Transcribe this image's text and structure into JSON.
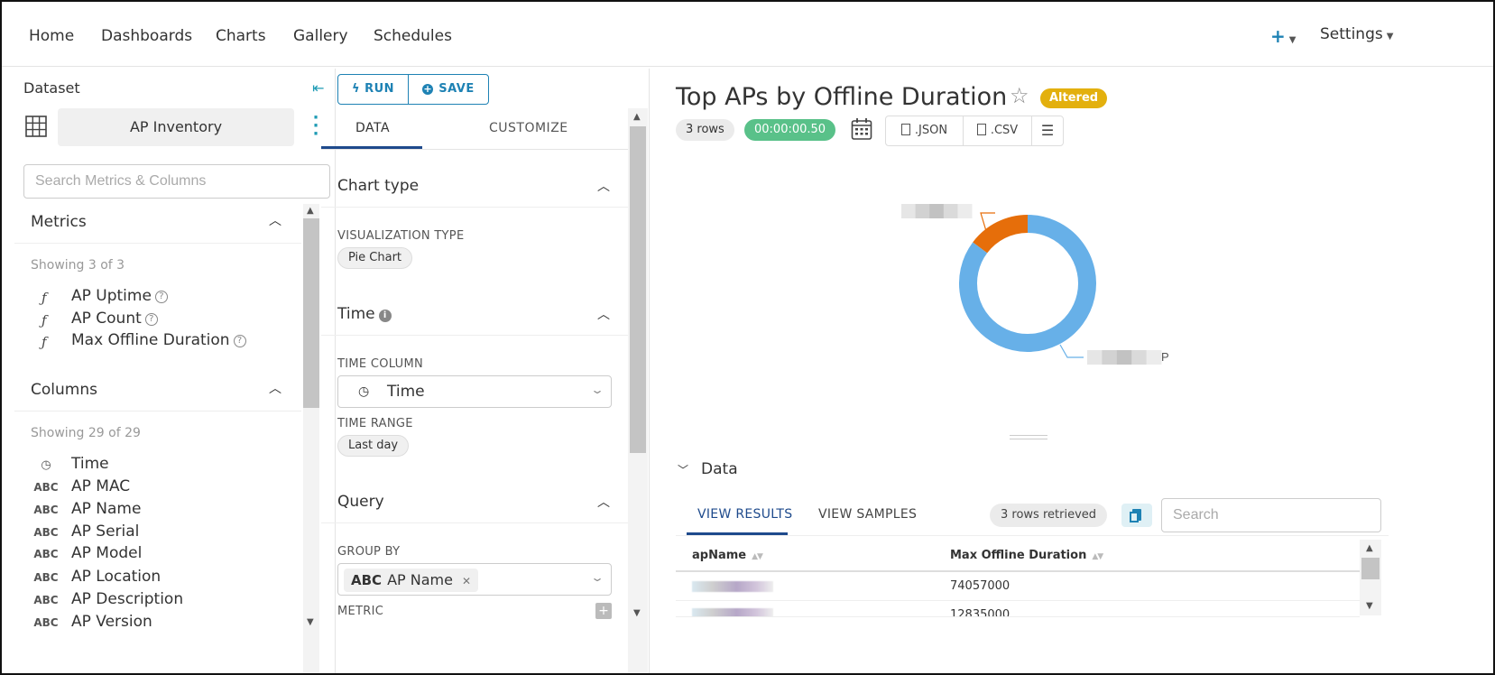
{
  "nav": {
    "items": [
      "Home",
      "Dashboards",
      "Charts",
      "Gallery",
      "Schedules"
    ],
    "settings": "Settings",
    "plus_label": "+"
  },
  "dataset": {
    "title": "Dataset",
    "name": "AP Inventory",
    "search_placeholder": "Search Metrics & Columns",
    "metrics_title": "Metrics",
    "metrics_showing": "Showing 3 of 3",
    "metrics": [
      "AP Uptime",
      "AP Count",
      "Max Offline Duration"
    ],
    "columns_title": "Columns",
    "columns_showing": "Showing 29 of 29",
    "columns": [
      {
        "type": "clock",
        "name": "Time"
      },
      {
        "type": "ABC",
        "name": "AP MAC"
      },
      {
        "type": "ABC",
        "name": "AP Name"
      },
      {
        "type": "ABC",
        "name": "AP Serial"
      },
      {
        "type": "ABC",
        "name": "AP Model"
      },
      {
        "type": "ABC",
        "name": "AP Location"
      },
      {
        "type": "ABC",
        "name": "AP Description"
      },
      {
        "type": "ABC",
        "name": "AP Version"
      }
    ]
  },
  "controls": {
    "run_label": "RUN",
    "save_label": "SAVE",
    "tab_data": "DATA",
    "tab_customize": "CUSTOMIZE",
    "chart_type_title": "Chart type",
    "viz_type_label": "VISUALIZATION TYPE",
    "viz_type_value": "Pie Chart",
    "time_title": "Time",
    "time_column_label": "TIME COLUMN",
    "time_column_value": "Time",
    "time_range_label": "TIME RANGE",
    "time_range_value": "Last day",
    "query_title": "Query",
    "group_by_label": "GROUP BY",
    "group_by_type": "ABC",
    "group_by_value": "AP Name",
    "metric_label": "METRIC"
  },
  "chart": {
    "title": "Top APs by Offline Duration",
    "altered": "Altered",
    "rows": "3 rows",
    "duration": "00:00:00.50",
    "json_btn": ".JSON",
    "csv_btn": ".CSV",
    "label_suffix": "P",
    "colors": {
      "primary": "#67b0e8",
      "secondary": "#e66e0a"
    }
  },
  "chart_data": {
    "type": "pie",
    "categories": [
      "",
      ""
    ],
    "values": [
      74057000,
      12835000
    ],
    "donut": true,
    "note_colors": [
      "#67b0e8",
      "#e66e0a"
    ]
  },
  "results": {
    "toggle_label": "Data",
    "tab_results": "VIEW RESULTS",
    "tab_samples": "VIEW SAMPLES",
    "retrieved": "3 rows retrieved",
    "search_placeholder": "Search",
    "headers": [
      "apName",
      "Max Offline Duration"
    ],
    "rows": [
      {
        "name": "",
        "value": "74057000"
      },
      {
        "name": "",
        "value": "12835000"
      }
    ]
  }
}
